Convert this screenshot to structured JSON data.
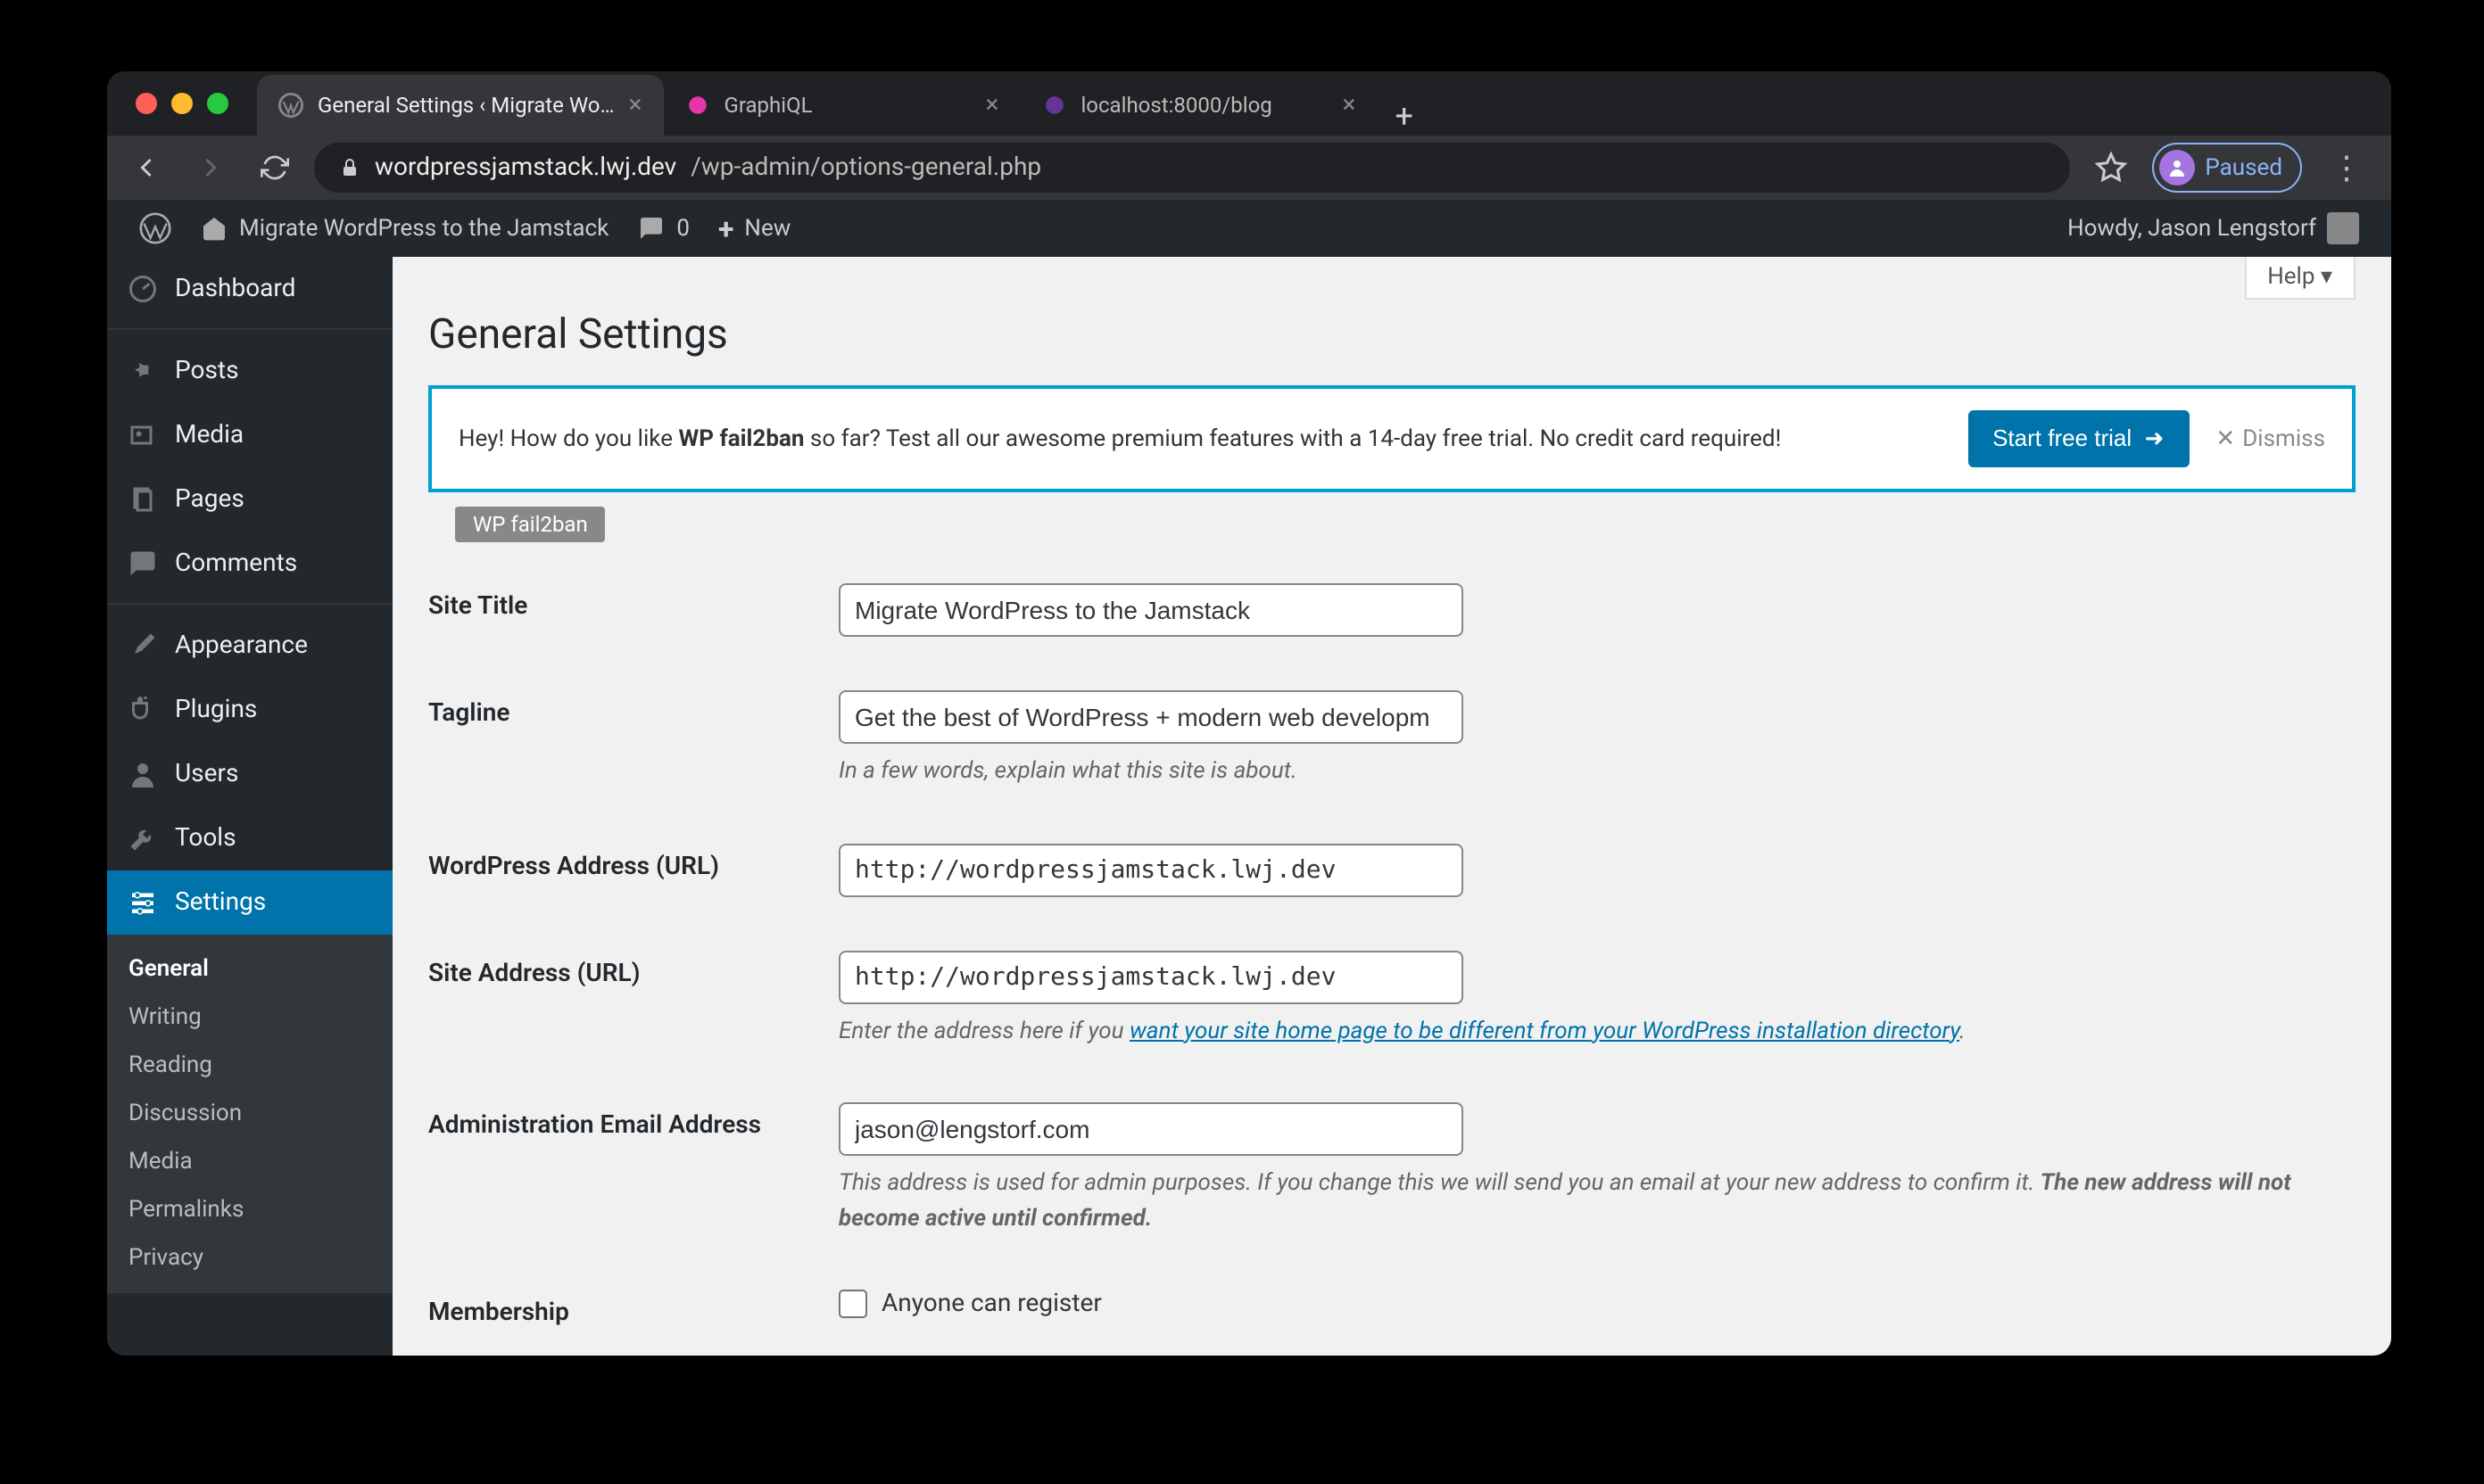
{
  "browser": {
    "tabs": [
      {
        "title": "General Settings ‹ Migrate Wo…",
        "active": true
      },
      {
        "title": "GraphiQL",
        "active": false
      },
      {
        "title": "localhost:8000/blog",
        "active": false
      }
    ],
    "url_host": "wordpressjamstack.lwj.dev",
    "url_path": "/wp-admin/options-general.php",
    "paused": "Paused"
  },
  "wpbar": {
    "site_name": "Migrate WordPress to the Jamstack",
    "comment_count": "0",
    "new_label": "New",
    "howdy": "Howdy, Jason Lengstorf"
  },
  "sidebar": {
    "items": [
      {
        "id": "dashboard",
        "label": "Dashboard"
      },
      {
        "id": "posts",
        "label": "Posts"
      },
      {
        "id": "media",
        "label": "Media"
      },
      {
        "id": "pages",
        "label": "Pages"
      },
      {
        "id": "comments",
        "label": "Comments"
      },
      {
        "id": "appearance",
        "label": "Appearance"
      },
      {
        "id": "plugins",
        "label": "Plugins"
      },
      {
        "id": "users",
        "label": "Users"
      },
      {
        "id": "tools",
        "label": "Tools"
      },
      {
        "id": "settings",
        "label": "Settings"
      }
    ],
    "submenu": [
      {
        "label": "General",
        "active": true
      },
      {
        "label": "Writing",
        "active": false
      },
      {
        "label": "Reading",
        "active": false
      },
      {
        "label": "Discussion",
        "active": false
      },
      {
        "label": "Media",
        "active": false
      },
      {
        "label": "Permalinks",
        "active": false
      },
      {
        "label": "Privacy",
        "active": false
      }
    ]
  },
  "content": {
    "help": "Help",
    "page_title": "General Settings",
    "notice": {
      "prefix": "Hey! How do you like ",
      "bold": "WP fail2ban",
      "suffix": " so far? Test all our awesome premium features with a 14-day free trial. No credit card required!",
      "button": "Start free trial",
      "dismiss": "Dismiss"
    },
    "badge": "WP fail2ban",
    "form": {
      "site_title": {
        "label": "Site Title",
        "value": "Migrate WordPress to the Jamstack"
      },
      "tagline": {
        "label": "Tagline",
        "value": "Get the best of WordPress + modern web developm",
        "desc": "In a few words, explain what this site is about."
      },
      "wp_url": {
        "label": "WordPress Address (URL)",
        "value": "http://wordpressjamstack.lwj.dev"
      },
      "site_url": {
        "label": "Site Address (URL)",
        "value": "http://wordpressjamstack.lwj.dev",
        "desc_pre": "Enter the address here if you ",
        "desc_link": "want your site home page to be different from your WordPress installation directory",
        "desc_post": "."
      },
      "admin_email": {
        "label": "Administration Email Address",
        "value": "jason@lengstorf.com",
        "desc_1": "This address is used for admin purposes. If you change this we will send you an email at your new address to confirm it. ",
        "desc_2": "The new address will not become active until confirmed."
      },
      "membership": {
        "label": "Membership",
        "checkbox_label": "Anyone can register"
      }
    }
  }
}
